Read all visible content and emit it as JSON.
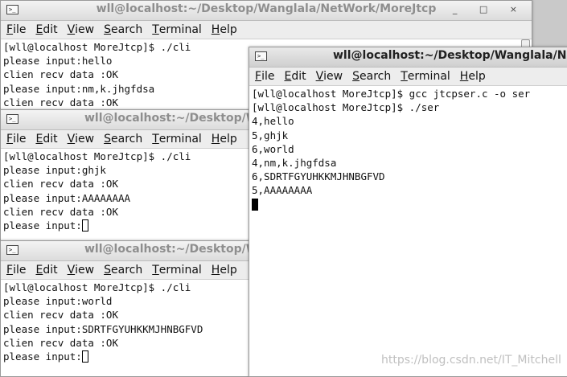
{
  "menu": [
    {
      "letter": "F",
      "rest": "ile"
    },
    {
      "letter": "E",
      "rest": "dit"
    },
    {
      "letter": "V",
      "rest": "iew"
    },
    {
      "letter": "S",
      "rest": "earch"
    },
    {
      "letter": "T",
      "rest": "erminal"
    },
    {
      "letter": "H",
      "rest": "elp"
    }
  ],
  "windows": {
    "w1": {
      "title": "wll@localhost:~/Desktop/Wanglala/NetWork/MoreJtcp",
      "lines": [
        "[wll@localhost MoreJtcp]$ ./cli",
        "please input:hello",
        "clien recv data :OK",
        "please input:nm,k.jhgfdsa",
        "clien recv data :OK"
      ]
    },
    "w2": {
      "title": "wll@localhost:~/Desktop/Wanglala/NetWork/MoreJtcp",
      "lines": [
        "[wll@localhost MoreJtcp]$ ./cli",
        "please input:ghjk",
        "clien recv data :OK",
        "please input:AAAAAAAA",
        "clien recv data :OK"
      ],
      "prompt": "please input:"
    },
    "w3": {
      "title": "wll@localhost:~/Desktop/Wanglala/NetWork/MoreJtcp",
      "lines": [
        "[wll@localhost MoreJtcp]$ ./cli",
        "please input:world",
        "clien recv data :OK",
        "please input:SDRTFGYUHKKMJHNBGFVD",
        "clien recv data :OK"
      ],
      "prompt": "please input:"
    },
    "w4": {
      "title": "wll@localhost:~/Desktop/Wanglala/NetWork/MoreJtcp",
      "lines": [
        "[wll@localhost MoreJtcp]$ gcc jtcpser.c -o ser",
        "[wll@localhost MoreJtcp]$ ./ser",
        "4,hello",
        "5,ghjk",
        "6,world",
        "4,nm,k.jhgfdsa",
        "6,SDRTFGYUHKKMJHNBGFVD",
        "5,AAAAAAAA"
      ]
    }
  },
  "window_buttons": "_ □ ×",
  "watermark": "https://blog.csdn.net/IT_Mitchell"
}
